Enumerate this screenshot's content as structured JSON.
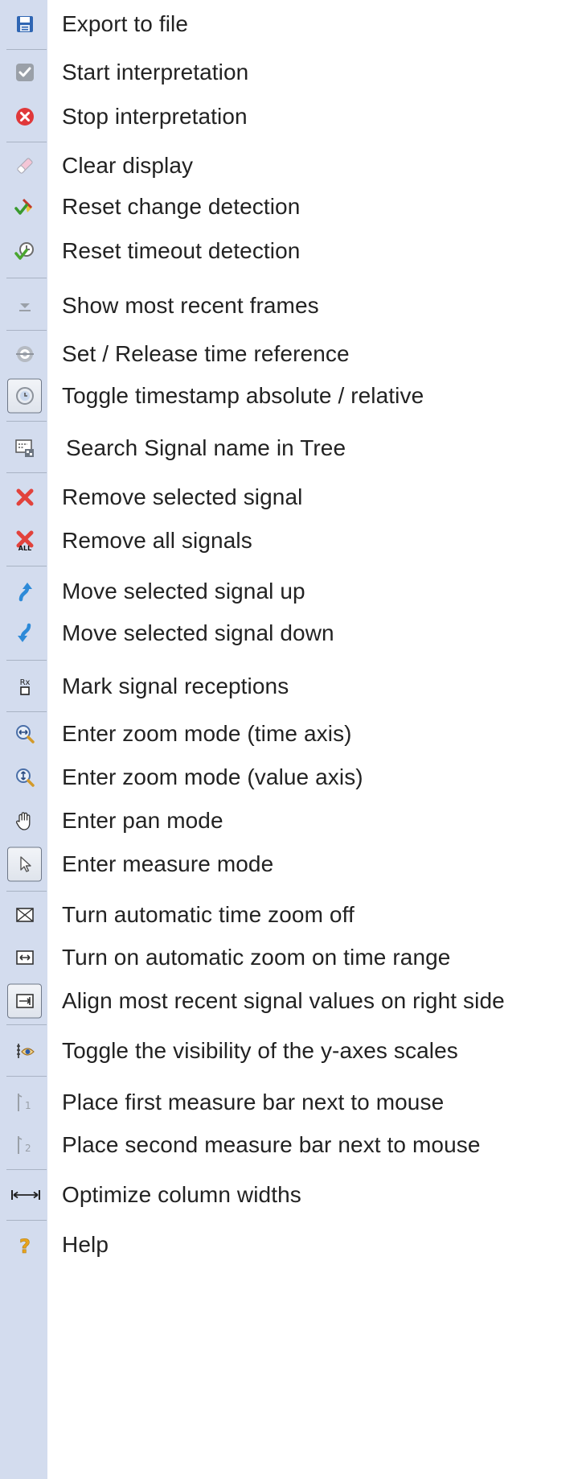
{
  "menu": {
    "items": [
      {
        "label": "Export to file",
        "icon": "floppy-disk-icon"
      },
      {
        "label": "Start interpretation",
        "icon": "checkmark-icon"
      },
      {
        "label": "Stop interpretation",
        "icon": "stop-circle-icon"
      },
      {
        "label": "Clear display",
        "icon": "eraser-icon"
      },
      {
        "label": "Reset change detection",
        "icon": "broom-check-icon"
      },
      {
        "label": "Reset timeout detection",
        "icon": "timer-check-icon"
      },
      {
        "label": "Show most recent frames",
        "icon": "arrow-down-icon"
      },
      {
        "label": "Set / Release time reference",
        "icon": "target-icon"
      },
      {
        "label": "Toggle timestamp absolute / relative",
        "icon": "clock-icon"
      },
      {
        "label": "Search Signal name in Tree",
        "icon": "tree-search-icon"
      },
      {
        "label": "Remove selected signal",
        "icon": "red-x-icon"
      },
      {
        "label": "Remove all signals",
        "icon": "red-x-all-icon"
      },
      {
        "label": "Move selected signal up",
        "icon": "arrow-up-curved-icon"
      },
      {
        "label": "Move selected signal down",
        "icon": "arrow-down-curved-icon"
      },
      {
        "label": "Mark signal receptions",
        "icon": "rx-mark-icon"
      },
      {
        "label": "Enter zoom mode (time axis)",
        "icon": "zoom-horizontal-icon"
      },
      {
        "label": "Enter zoom mode (value axis)",
        "icon": "zoom-vertical-icon"
      },
      {
        "label": "Enter pan mode",
        "icon": "hand-icon"
      },
      {
        "label": "Enter measure mode",
        "icon": "cursor-arrow-icon"
      },
      {
        "label": "Turn automatic time zoom off",
        "icon": "zoom-off-icon"
      },
      {
        "label": "Turn on automatic zoom on time range",
        "icon": "zoom-range-icon"
      },
      {
        "label": "Align most recent signal values on right side",
        "icon": "align-right-icon"
      },
      {
        "label": "Toggle the visibility of the y-axes scales",
        "icon": "eye-axis-icon"
      },
      {
        "label": "Place first measure bar next to mouse",
        "icon": "measure-bar-1-icon"
      },
      {
        "label": "Place second measure bar next to mouse",
        "icon": "measure-bar-2-icon"
      },
      {
        "label": "Optimize column widths",
        "icon": "column-width-icon"
      },
      {
        "label": "Help",
        "icon": "question-icon"
      }
    ],
    "checked": [
      "Toggle timestamp absolute / relative",
      "Enter measure mode",
      "Align most recent signal values on right side"
    ],
    "colors": {
      "gutter": "#d3dcee",
      "separator": "#a9b3c4",
      "text": "#222222"
    }
  }
}
